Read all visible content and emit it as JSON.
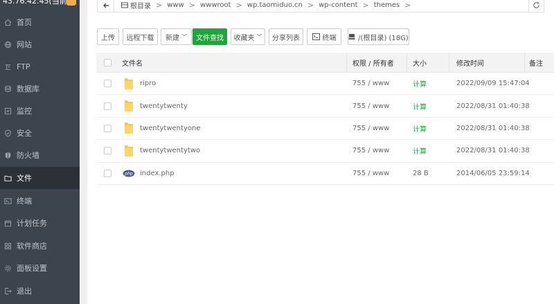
{
  "sidebar": {
    "header_ip": "43.76.42.45(当前",
    "items": [
      {
        "label": "首页",
        "icon": "home-icon"
      },
      {
        "label": "网站",
        "icon": "globe-icon"
      },
      {
        "label": "FTP",
        "icon": "ftp-icon"
      },
      {
        "label": "数据库",
        "icon": "database-icon"
      },
      {
        "label": "监控",
        "icon": "monitor-icon"
      },
      {
        "label": "安全",
        "icon": "shield-icon"
      },
      {
        "label": "防火墙",
        "icon": "firewall-icon"
      },
      {
        "label": "文件",
        "icon": "folder-icon",
        "active": true
      },
      {
        "label": "终端",
        "icon": "terminal-icon"
      },
      {
        "label": "计划任务",
        "icon": "calendar-icon"
      },
      {
        "label": "软件商店",
        "icon": "grid-icon"
      },
      {
        "label": "面板设置",
        "icon": "gear-icon"
      },
      {
        "label": "退出",
        "icon": "logout-icon"
      }
    ]
  },
  "path": {
    "root": "根目录",
    "segments": [
      "www",
      "wwwroot",
      "wp.taomiduo.cn",
      "wp-content",
      "themes"
    ]
  },
  "toolbar": {
    "upload": "上传",
    "remote_download": "远程下载",
    "new": "新建",
    "file_search": "文件查找",
    "favorites": "收藏夹",
    "share_list": "分享列表",
    "terminal": "终端",
    "disk": "/(根目录) (18G)"
  },
  "table": {
    "headers": {
      "name": "文件名",
      "perm": "权限 / 所有者",
      "size": "大小",
      "mtime": "修改时间",
      "note": "备注"
    },
    "rows": [
      {
        "name": "ripro",
        "type": "folder",
        "perm": "755 / www",
        "size": "计算",
        "mtime": "2022/09/09 15:47:04"
      },
      {
        "name": "twentytwenty",
        "type": "folder",
        "perm": "755 / www",
        "size": "计算",
        "mtime": "2022/08/31 01:40:38"
      },
      {
        "name": "twentytwentyone",
        "type": "folder",
        "perm": "755 / www",
        "size": "计算",
        "mtime": "2022/08/31 01:40:38"
      },
      {
        "name": "twentytwentytwo",
        "type": "folder",
        "perm": "755 / www",
        "size": "计算",
        "mtime": "2022/08/31 01:40:38"
      },
      {
        "name": "index.php",
        "type": "php",
        "perm": "755 / www",
        "size": "28 B",
        "mtime": "2014/06/05 23:59:14"
      }
    ]
  },
  "colors": {
    "sidebar_bg": "#3c444d",
    "sidebar_active": "#2c3138",
    "accent_green": "#20a53a",
    "folder_yellow": "#f7c84a"
  }
}
